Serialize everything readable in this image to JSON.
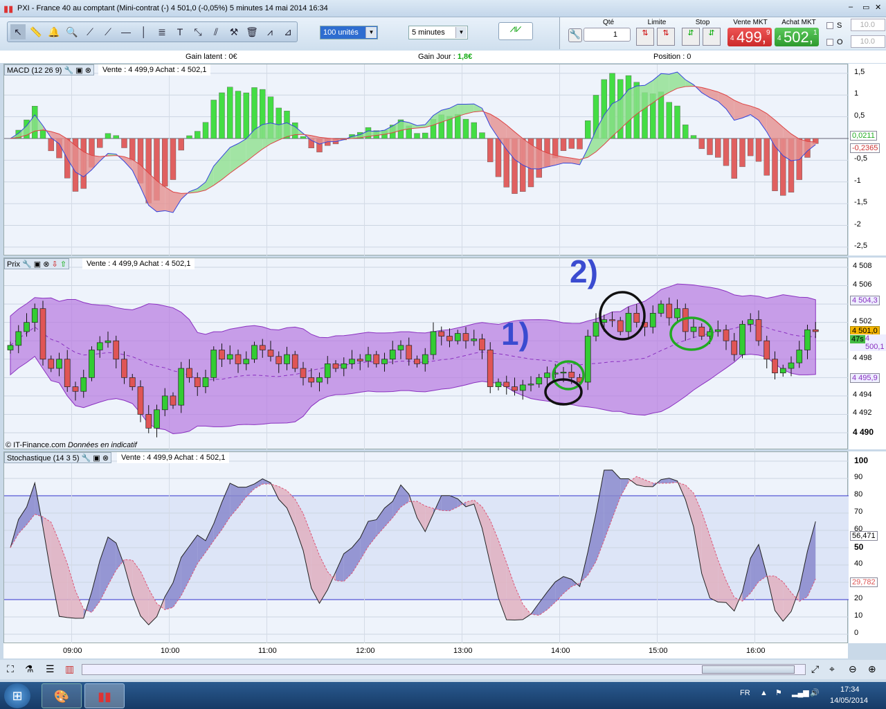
{
  "window": {
    "title": "PXI - France 40 au comptant (Mini-contrat  (-)   4 501,0 (-0,05%)     5 minutes  14 mai 2014 16:34"
  },
  "toolbar": {
    "tools": [
      "pointer-icon",
      "ruler-icon",
      "alarm-bell-icon",
      "magnifier-icon",
      "segment-icon",
      "trend-line-icon",
      "horizontal-line-icon",
      "vertical-line-icon",
      "fibonacci-icon",
      "text-icon",
      "channel-icon",
      "parallel-line-icon",
      "tools-icon",
      "trash-icon",
      "zigzag-icon",
      "triangle-icon"
    ],
    "quantity_select": "100 unités",
    "timeframe_select": "5 minutes",
    "qty_label": "Qté",
    "qty_value": "1",
    "limit_label": "Limite",
    "stop_label": "Stop",
    "sell_label": "Vente MKT",
    "sell_big": "499,",
    "sell_prefix": "4",
    "sell_dec": "9",
    "buy_label": "Achat MKT",
    "buy_big": "502,",
    "buy_prefix": "4",
    "buy_dec": "1",
    "s_label": "S",
    "o_label": "O",
    "s_value": "10.0",
    "o_value": "10.0"
  },
  "info": {
    "gain_latent": "Gain latent : 0€",
    "gain_jour_label": "Gain Jour : ",
    "gain_jour_value": "1,8€",
    "position": "Position : 0"
  },
  "macd": {
    "title": "MACD (12 26 9)",
    "quote": "Vente : 4 499,9 Achat : 4 502,1",
    "ticks": [
      "1,5",
      "1",
      "0,5",
      "-0,5",
      "-1",
      "-1,5",
      "-2",
      "-2,5"
    ],
    "value1": "0,0211",
    "value2": "-0,2365"
  },
  "price": {
    "title": "Prix",
    "quote": "Vente : 4 499,9 Achat : 4 502,1",
    "ticks": [
      "4 508",
      "4 506",
      "4 502",
      "4 498",
      "4 494",
      "4 492",
      "4 490"
    ],
    "upper": "4 504,3",
    "last": "4 501,0",
    "mid": "4 500,1",
    "timer": "47s",
    "lower": "4 495,9",
    "copyright": "© IT-Finance.com",
    "copyright2": "Données en indicatif",
    "annot1": "1)",
    "annot2": "2)"
  },
  "stoch": {
    "title": "Stochastique (14 3 5)",
    "quote": "Vente : 4 499,9 Achat : 4 502,1",
    "ticks": [
      "100",
      "90",
      "80",
      "70",
      "60",
      "50",
      "40",
      "30",
      "20",
      "10",
      "0"
    ],
    "k": "56,471",
    "d": "29,782"
  },
  "time_axis": [
    "09:00",
    "10:00",
    "11:00",
    "12:00",
    "13:00",
    "14:00",
    "15:00",
    "16:00"
  ],
  "taskbar": {
    "lang": "FR",
    "time": "17:34",
    "date": "14/05/2014"
  },
  "colors": {
    "up": "#33cc33",
    "down": "#e05555",
    "bands": "#b678e0",
    "stoch_line": "#222222",
    "macd_pos": "#44dd44",
    "macd_neg": "#e06060"
  },
  "chart_data": {
    "type": "candlestick",
    "interval": "5 minutes",
    "first_bar": "08:20",
    "last_bar": "16:30",
    "ylim": [
      4489,
      4509
    ],
    "closes": [
      4499.5,
      4501,
      4502,
      4503.5,
      4498,
      4497,
      4498,
      4495,
      4494.5,
      4496,
      4499,
      4499.8,
      4500,
      4498,
      4496,
      4495,
      4492,
      4490.5,
      4492.5,
      4494,
      4493,
      4497,
      4496,
      4495,
      4496,
      4499,
      4498,
      4498.5,
      4497.5,
      4498,
      4499.5,
      4499,
      4498.3,
      4497.5,
      4498.5,
      4497,
      4496,
      4495.5,
      4496,
      4497.5,
      4497,
      4497.5,
      4498,
      4497.8,
      4498.5,
      4497.5,
      4498,
      4499,
      4499.5,
      4498,
      4497.5,
      4498.5,
      4501,
      4500.5,
      4500,
      4500.8,
      4500,
      4500.2,
      4499,
      4495,
      4495.5,
      4495,
      4494.6,
      4495.2,
      4495.3,
      4496,
      4496.5,
      4496.5,
      4496.6,
      4496,
      4495.5,
      4500.5,
      4502,
      4502.3,
      4502.2,
      4501,
      4503,
      4502,
      4501.5,
      4503,
      4504,
      4502.5,
      4503.5,
      4501,
      4501.5,
      4500.5,
      4501,
      4501.2,
      4500,
      4498.5,
      4501.8,
      4502.3,
      4500,
      4498,
      4496.5,
      4497,
      4497.6,
      4499,
      4501.2,
      4501.0
    ],
    "indicators": [
      "Bollinger bands",
      "MACD (12 26 9)",
      "Stochastique (14 3 5)"
    ]
  }
}
